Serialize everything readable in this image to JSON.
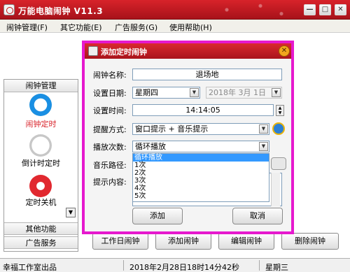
{
  "window": {
    "title": "万能电脑闹钟 V11.3",
    "minimize": "—",
    "maximize": "□",
    "close": "✕"
  },
  "menu": [
    "闹钟管理(F)",
    "其它功能(E)",
    "广告服务(G)",
    "使用帮助(H)"
  ],
  "sidebar": {
    "header": "闹钟管理",
    "items": [
      {
        "label": "闹钟定时",
        "icon": "alarm-clock-icon",
        "active": true,
        "color": "#d8232a"
      },
      {
        "label": "倒计时定时",
        "icon": "stopwatch-icon",
        "active": false,
        "color": "#000000"
      },
      {
        "label": "定时关机",
        "icon": "power-icon",
        "active": false,
        "color": "#000000"
      }
    ],
    "scroll_down": "▼",
    "footer_items": [
      "其他功能",
      "广告服务"
    ]
  },
  "bottom_buttons": [
    "工作日闹钟",
    "添加闹钟",
    "编辑闹钟",
    "删除闹钟"
  ],
  "status": {
    "left": "幸福工作室出品",
    "datetime": "2018年2月28日18时14分42秒",
    "weekday": "星期三"
  },
  "dialog": {
    "title": "添加定时闹钟",
    "close": "✕",
    "fields": {
      "name_label": "闹钟名称:",
      "name_value": "退场地",
      "date_label": "设置日期:",
      "weekday_value": "星期四",
      "date_value": "2018年 3月 1日",
      "time_label": "设置时间:",
      "time_value": "14:14:05",
      "remind_label": "提醒方式:",
      "remind_value": "窗口提示 + 音乐提示",
      "play_label": "播放次数:",
      "play_value": "循环播放",
      "music_label": "音乐路径:",
      "content_label": "提示内容:"
    },
    "play_options": [
      "循环播放",
      "1次",
      "2次",
      "3次",
      "4次",
      "5次"
    ],
    "play_selected_index": 0,
    "ok": "添加",
    "cancel": "取消",
    "accent": "#e619ce"
  }
}
